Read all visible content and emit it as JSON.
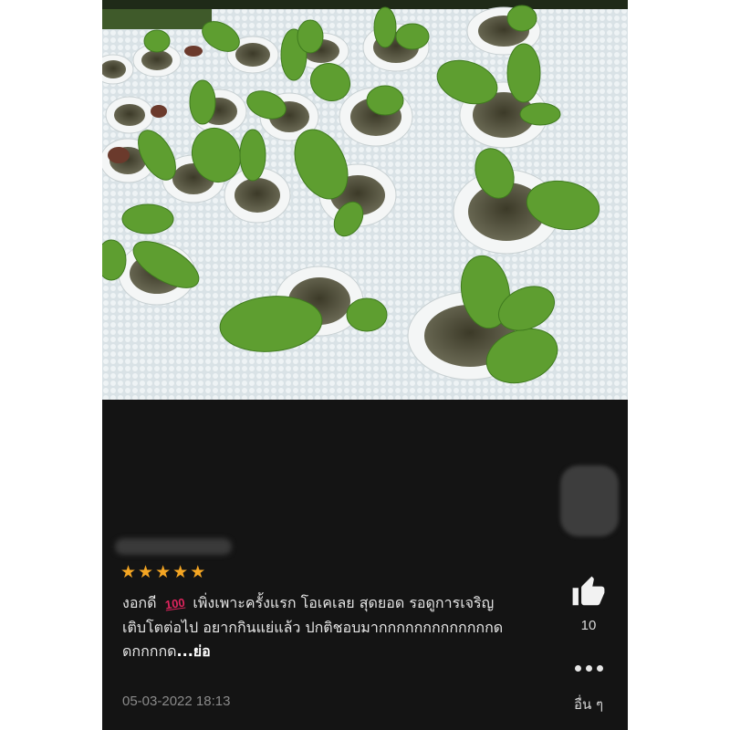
{
  "review": {
    "rating_stars": 5,
    "text_before_emoji": "งอกดี",
    "emoji": "100",
    "text_after_emoji": "เพิ่งเพาะครั้งแรก โอเคเลย สุดยอด รอดูการเจริญเติบโตต่อไป อยากกินแย่แล้ว ปกติชอบมากกกกกกกกกกกกกดดกกกกด",
    "collapse_label": "...ย่อ",
    "date": "05-03-2022 18:13"
  },
  "actions": {
    "like_count": "10",
    "other_label": "อื่น ๆ"
  },
  "colors": {
    "background": "#141414",
    "star": "#f5a623",
    "foam_board": "#dfe7ea",
    "leaf": "#5a9a2e"
  },
  "icons": {
    "like": "thumbs-up-icon",
    "more": "more-dots-icon",
    "star": "star-icon"
  }
}
